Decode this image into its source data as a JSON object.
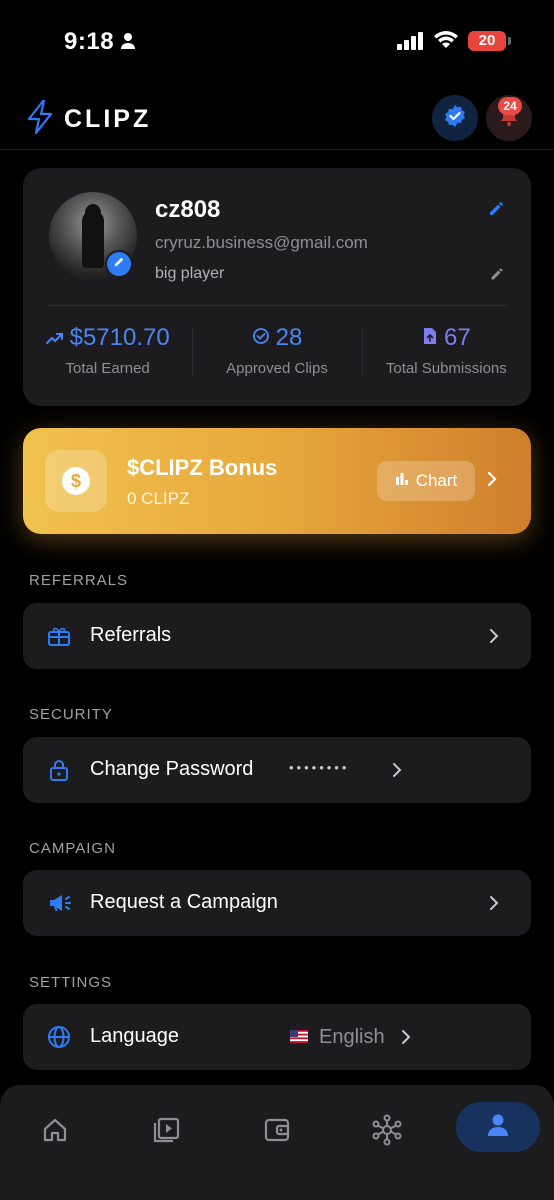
{
  "status_bar": {
    "time": "9:18",
    "battery": "20"
  },
  "header": {
    "brand": "CLIPZ",
    "notification_count": "24"
  },
  "profile": {
    "username": "cz808",
    "email": "cryruz.business@gmail.com",
    "bio": "big player",
    "stats": [
      {
        "value": "$5710.70",
        "label": "Total Earned",
        "icon": "trending-up-icon"
      },
      {
        "value": "28",
        "label": "Approved Clips",
        "icon": "check-circle-icon"
      },
      {
        "value": "67",
        "label": "Total Submissions",
        "icon": "upload-file-icon"
      }
    ]
  },
  "bonus": {
    "title": "$CLIPZ Bonus",
    "amount": "0 CLIPZ",
    "chart_label": "Chart"
  },
  "sections": {
    "referrals": {
      "title": "REFERRALS",
      "item": "Referrals"
    },
    "security": {
      "title": "SECURITY",
      "item": "Change Password",
      "value": "••••••••"
    },
    "campaign": {
      "title": "CAMPAIGN",
      "item": "Request a Campaign"
    },
    "settings": {
      "title": "SETTINGS",
      "item": "Language",
      "value": "English"
    }
  },
  "nav": {
    "items": [
      "home-icon",
      "clips-icon",
      "wallet-icon",
      "network-icon",
      "profile-icon"
    ],
    "active": "profile-icon"
  },
  "colors": {
    "accent": "#4a86f5",
    "bonus_gradient_start": "#f1c24d",
    "bonus_gradient_end": "#cf7f2b",
    "card": "#1c1c1f"
  }
}
